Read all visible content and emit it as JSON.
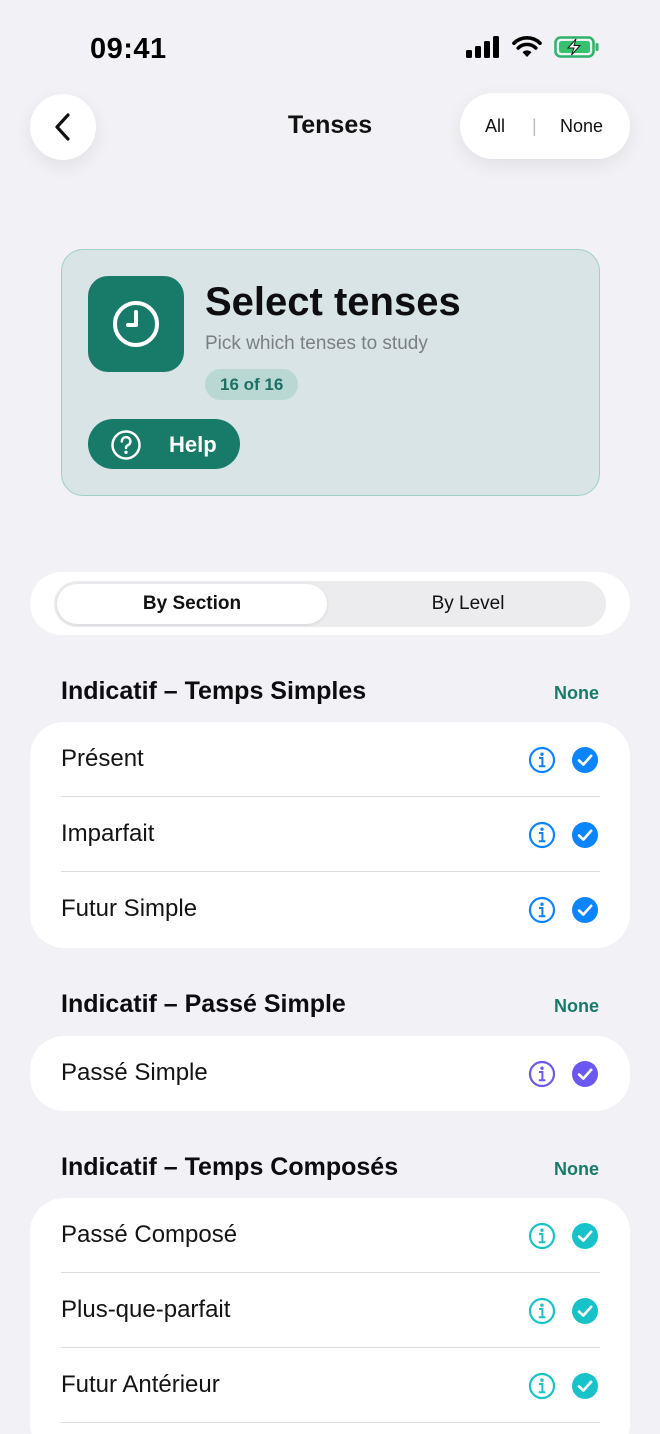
{
  "status": {
    "time": "09:41"
  },
  "nav": {
    "title": "Tenses",
    "all_label": "All",
    "divider": "|",
    "none_label": "None"
  },
  "header": {
    "title": "Select tenses",
    "subtitle": "Pick which tenses to study",
    "count": "16 of 16",
    "help_label": "Help"
  },
  "segments": {
    "active": "By Section",
    "inactive": "By Level"
  },
  "sections": [
    {
      "title": "Indicatif – Temps Simples",
      "none_label": "None",
      "accent": "#0a84ff",
      "items": [
        {
          "label": "Présent",
          "checked": true
        },
        {
          "label": "Imparfait",
          "checked": true
        },
        {
          "label": "Futur Simple",
          "checked": true
        }
      ]
    },
    {
      "title": "Indicatif – Passé Simple",
      "none_label": "None",
      "accent": "#6a58f0",
      "items": [
        {
          "label": "Passé Simple",
          "checked": true
        }
      ]
    },
    {
      "title": "Indicatif – Temps Composés",
      "none_label": "None",
      "accent": "#17c3c9",
      "items": [
        {
          "label": "Passé Composé",
          "checked": true
        },
        {
          "label": "Plus-que-parfait",
          "checked": true
        },
        {
          "label": "Futur Antérieur",
          "checked": true
        }
      ]
    }
  ],
  "colors": {
    "brand": "#187a68",
    "background": "#f1f1f6"
  }
}
